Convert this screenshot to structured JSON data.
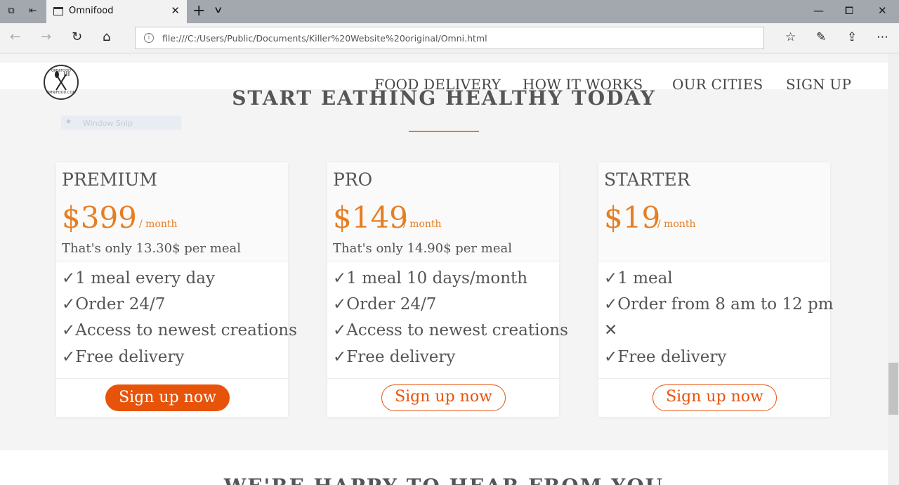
{
  "browser": {
    "tab_title": "Omnifood",
    "url": "file:///C:/Users/Public/Documents/Killer%20Website%20original/Omni.html",
    "icons": [
      "set-aside-tabs-icon",
      "tab-preview-icon",
      "close-tab-icon",
      "new-tab-icon",
      "tab-list-icon",
      "minimize-icon",
      "restore-icon",
      "close-window-icon",
      "back-icon",
      "forward-icon",
      "refresh-icon",
      "home-icon",
      "site-info-icon",
      "favorites-icon",
      "ink-icon",
      "share-icon",
      "more-icon"
    ]
  },
  "site": {
    "logo_top": "OMNIFOOD",
    "logo_bottom": "OMNIFOOD.COM",
    "nav": [
      "FOOD DELIVERY",
      "HOW IT WORKS",
      "OUR CITIES",
      "SIGN UP"
    ],
    "section_title": "START EATHING HEALTHY TODAY",
    "snip_label": "Window Snip",
    "next_section_title": "WE'RE HAPPY TO HEAR FROM YOU"
  },
  "plans": [
    {
      "name": "PREMIUM",
      "price": "$399",
      "per": "/ month",
      "per_meal": "That's only 13.30$ per meal",
      "features": [
        "✓1 meal every day",
        "✓Order 24/7",
        "✓Access to newest creations",
        "✓Free delivery"
      ],
      "button": "Sign up now"
    },
    {
      "name": "PRO",
      "price": "$149",
      "per": "/ month",
      "per_meal": "That's only 14.90$ per meal",
      "features": [
        "✓1 meal 10 days/month",
        "✓Order 24/7",
        "✓Access to newest creations",
        "✓Free delivery"
      ],
      "button": "Sign up now"
    },
    {
      "name": "STARTER",
      "price": "$19",
      "per": "/ month",
      "per_meal": "",
      "features": [
        "✓1 meal",
        "✓Order from 8 am to 12 pm",
        "✕",
        "✓Free delivery"
      ],
      "button": "Sign up now"
    }
  ],
  "colors": {
    "accent": "#e67e22",
    "button": "#e8530a"
  }
}
